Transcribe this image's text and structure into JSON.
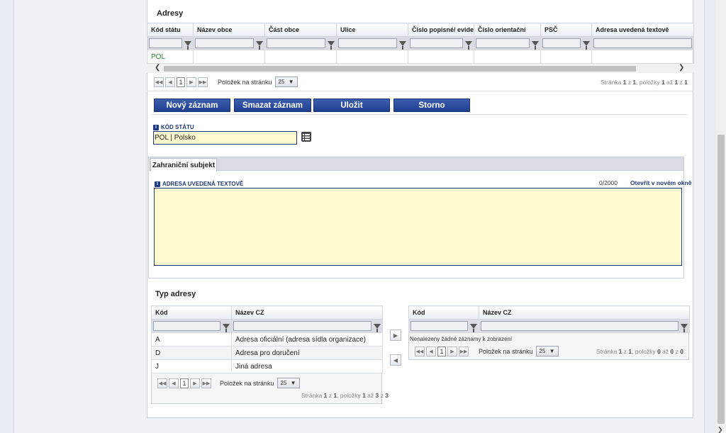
{
  "addresses": {
    "title": "Adresy",
    "columns": [
      "Kód státu",
      "Název obce",
      "Část obce",
      "Ulice",
      "Číslo popisné/ evidenční",
      "Číslo orientační",
      "PSČ",
      "Adresa uvedená textově"
    ],
    "rows": [
      [
        "POL",
        "",
        "",
        "",
        "",
        "",
        "",
        ""
      ]
    ],
    "pager": {
      "page": "1",
      "per_page_label": "Položek na stránku",
      "per_page": "25",
      "info_prefix": "Stránka",
      "page_cur": "1",
      "of": "z",
      "page_total": "1",
      "items_label": ", položky",
      "from": "1",
      "to_label": "až",
      "to": "1",
      "total": "1"
    }
  },
  "actions": {
    "new": "Nový záznam",
    "delete": "Smazat záznam",
    "save": "Uložit",
    "cancel": "Storno"
  },
  "country_field": {
    "label": "KÓD STÁTU",
    "value": "POL | Polsko"
  },
  "tabs": {
    "active": "Zahraniční subjekt"
  },
  "address_text": {
    "label": "ADRESA UVEDENÁ TEXTOVĚ",
    "counter": "0/2000",
    "open_link": "Otevřít v novém okně",
    "value": ""
  },
  "address_type": {
    "title": "Typ adresy",
    "left": {
      "columns": [
        "Kód",
        "Název CZ"
      ],
      "rows": [
        [
          "A",
          "Adresa oficiální (adresa sídla organizace)"
        ],
        [
          "D",
          "Adresa pro doručení"
        ],
        [
          "J",
          "Jiná adresa"
        ]
      ],
      "pager": {
        "page": "1",
        "per_page_label": "Položek na stránku",
        "per_page": "25",
        "info_prefix": "Stránka",
        "page_cur": "1",
        "of": "z",
        "page_total": "1",
        "items_label": ", položky",
        "from": "1",
        "to_label": "až",
        "to": "3",
        "total": "3"
      }
    },
    "right": {
      "columns": [
        "Kód",
        "Název CZ"
      ],
      "empty_message": "Nenalezeny žádné záznamy k zobrazení",
      "pager": {
        "page": "1",
        "per_page_label": "Položek na stránku",
        "per_page": "25",
        "info_prefix": "Stránka",
        "page_cur": "1",
        "of": "z",
        "page_total": "1",
        "items_label": ", položky",
        "from": "0",
        "to_label": "až",
        "to": "0",
        "total": "0"
      }
    }
  },
  "colors": {
    "accent": "#1f3f8f",
    "input_yellow": "#fefbd0",
    "link_green": "#2e8b2e"
  }
}
